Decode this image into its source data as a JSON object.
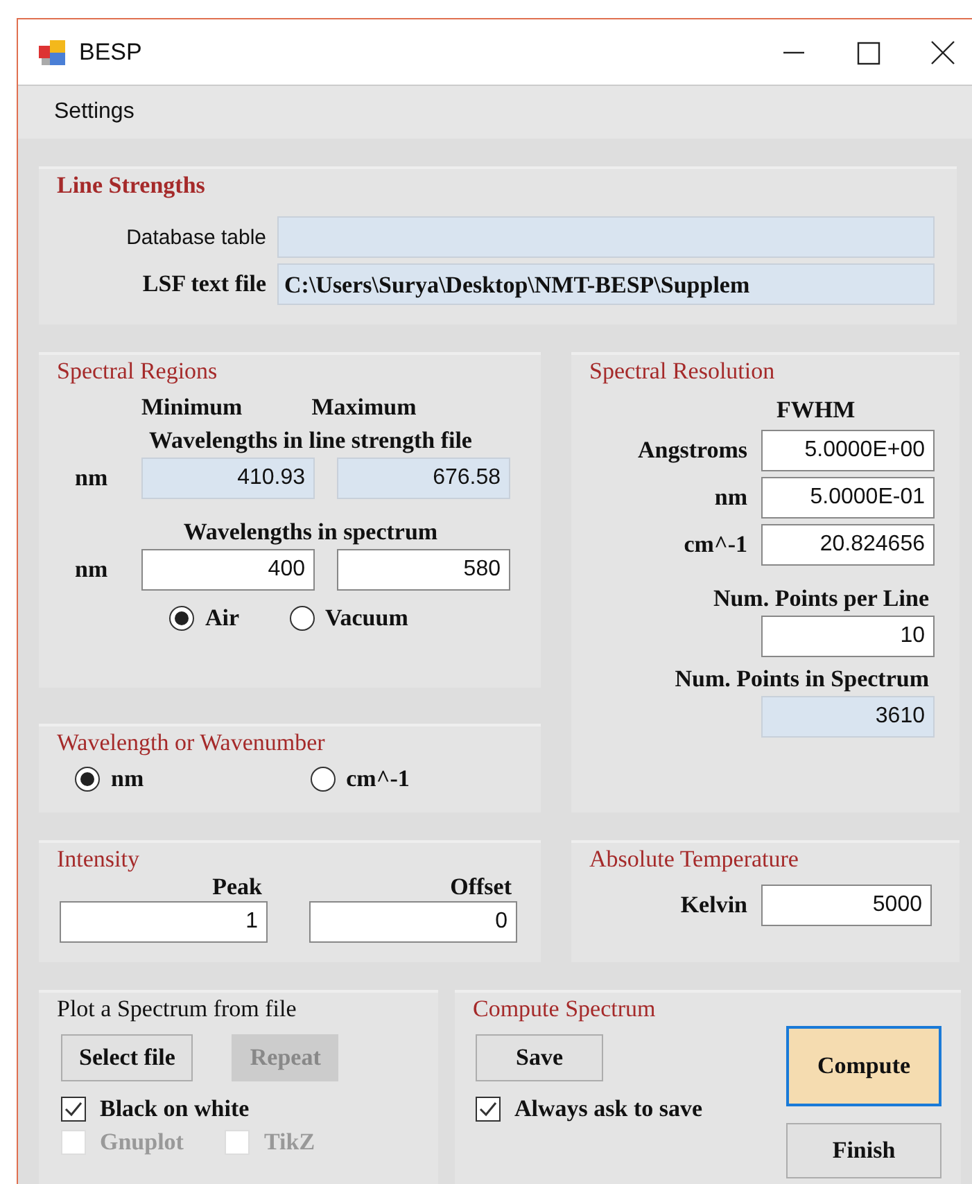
{
  "window": {
    "title": "BESP"
  },
  "menu": [
    {
      "label": "Settings"
    }
  ],
  "line_strengths": {
    "title": "Line Strengths",
    "fields": [
      {
        "label": "Database table",
        "readonly": true
      },
      {
        "label": "LSF text file",
        "value": "C:\\Users\\Surya\\Desktop\\NMT-BESP\\Supplem",
        "readonly": true
      }
    ]
  },
  "spectral_regions": {
    "title": "Spectral Regions",
    "column_headers": [
      "Minimum",
      "Maximum"
    ],
    "groups": [
      {
        "caption": "Wavelengths in line strength file",
        "unit": "nm",
        "values": [
          {
            "value": "410.93",
            "readonly": true
          },
          {
            "value": "676.58",
            "readonly": true
          }
        ]
      },
      {
        "caption": "Wavelengths in spectrum",
        "unit": "nm",
        "values": [
          {
            "value": "400",
            "readonly": false
          },
          {
            "value": "580",
            "readonly": false
          }
        ]
      }
    ],
    "medium": [
      {
        "label": "Air",
        "selected": true
      },
      {
        "label": "Vacuum",
        "selected": false
      }
    ]
  },
  "wavelength_or_wavenumber": {
    "title": "Wavelength or Wavenumber",
    "options": [
      {
        "label": "nm",
        "selected": true
      },
      {
        "label": "cm^-1",
        "selected": false
      }
    ]
  },
  "spectral_resolution": {
    "title": "Spectral Resolution",
    "header": "FWHM",
    "rows": [
      {
        "label": "Angstroms",
        "value": "5.0000E+00",
        "readonly": false
      },
      {
        "label": "nm",
        "value": "5.0000E-01",
        "readonly": false
      },
      {
        "label": "cm^-1",
        "value": "20.824656",
        "readonly": false
      }
    ],
    "points_per_line": {
      "label": "Num. Points per Line",
      "value": "10",
      "readonly": false
    },
    "points_in_spectrum": {
      "label": "Num. Points in Spectrum",
      "value": "3610",
      "readonly": true
    }
  },
  "intensity": {
    "title": "Intensity",
    "fields": [
      {
        "label": "Peak",
        "value": "1",
        "readonly": false
      },
      {
        "label": "Offset",
        "value": "0",
        "readonly": false
      }
    ]
  },
  "temperature": {
    "title": "Absolute Temperature",
    "label": "Kelvin",
    "value": "5000",
    "readonly": false
  },
  "plot": {
    "title": "Plot a Spectrum from file",
    "buttons": [
      {
        "label": "Select file",
        "disabled": false
      },
      {
        "label": "Repeat",
        "disabled": true
      }
    ],
    "checkboxes": [
      {
        "label": "Black on white",
        "checked": true,
        "disabled": false
      },
      {
        "label": "Gnuplot",
        "checked": false,
        "disabled": true
      },
      {
        "label": "TikZ",
        "checked": false,
        "disabled": true
      }
    ]
  },
  "compute": {
    "title": "Compute Spectrum",
    "save_button": {
      "label": "Save"
    },
    "always_ask": {
      "label": "Always ask to save",
      "checked": true
    },
    "compute_button": {
      "label": "Compute",
      "focused": true
    },
    "finish_button": {
      "label": "Finish"
    }
  }
}
